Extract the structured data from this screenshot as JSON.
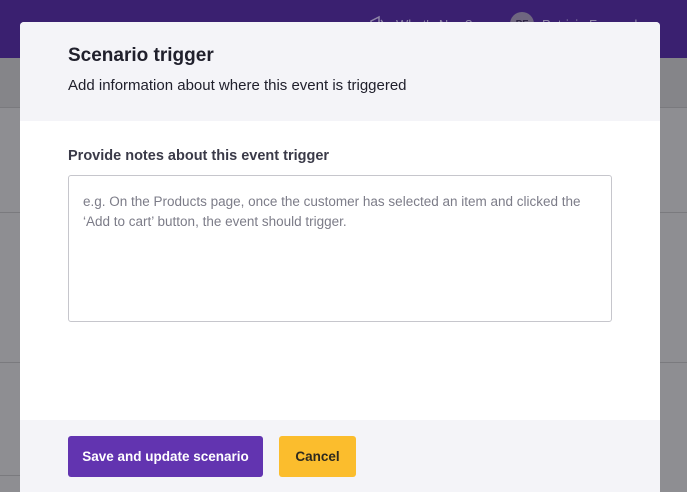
{
  "background": {
    "whats_new_label": "What's New?",
    "user_initials": "PF",
    "user_name": "Patricia Fernandes"
  },
  "modal": {
    "title": "Scenario trigger",
    "subtitle": "Add information about where this event is triggered",
    "field_label": "Provide notes about this event trigger",
    "textarea_value": "",
    "textarea_placeholder": "e.g. On the Products page, once the customer has selected an item and clicked the ‘Add to cart’ button, the event should trigger.",
    "save_button_label": "Save and update scenario",
    "cancel_button_label": "Cancel"
  },
  "colors": {
    "primary": "#6234b0",
    "cancel": "#fbbd2d",
    "topbar": "#3a2070"
  }
}
